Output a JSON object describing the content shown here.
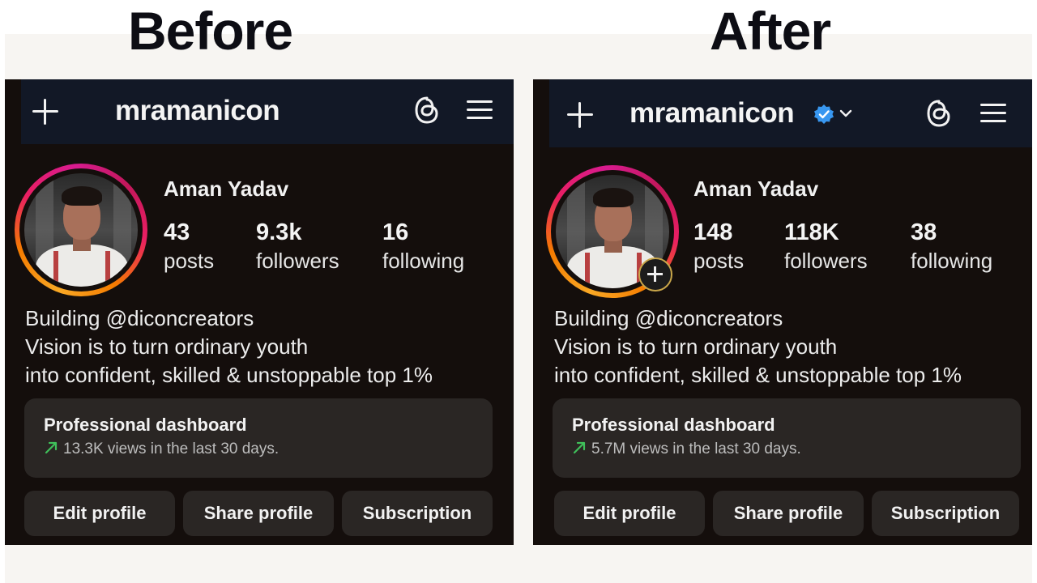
{
  "labels": {
    "before": "Before",
    "after": "After"
  },
  "before": {
    "username": "mramanicon",
    "full_name": "Aman Yadav",
    "stats": [
      {
        "value": "43",
        "label": "posts"
      },
      {
        "value": "9.3k",
        "label": "followers"
      },
      {
        "value": "16",
        "label": "following"
      }
    ],
    "bio": [
      "Building @diconcreators",
      "Vision is to turn ordinary youth",
      "into confident, skilled & unstoppable top 1%"
    ],
    "dashboard": {
      "title": "Professional dashboard",
      "subtitle": "13.3K views in the last 30 days."
    },
    "buttons": {
      "edit": "Edit profile",
      "share": "Share profile",
      "subscription": "Subscription"
    }
  },
  "after": {
    "username": "mramanicon",
    "full_name": "Aman Yadav",
    "stats": [
      {
        "value": "148",
        "label": "posts"
      },
      {
        "value": "118K",
        "label": "followers"
      },
      {
        "value": "38",
        "label": "following"
      }
    ],
    "bio": [
      "Building @diconcreators",
      "Vision is to turn ordinary youth",
      "into confident, skilled & unstoppable top 1%"
    ],
    "dashboard": {
      "title": "Professional dashboard",
      "subtitle": "5.7M views in the last 30 days."
    },
    "buttons": {
      "edit": "Edit profile",
      "share": "Share profile",
      "subscription": "Subscription"
    }
  },
  "colors": {
    "panel_bg": "#140e0c",
    "topbar_bg": "#121826",
    "card_bg": "#2a2624",
    "verified": "#3897f0",
    "trend": "#3fbf5a"
  },
  "icons": [
    "plus-icon",
    "threads-icon",
    "menu-icon",
    "verified-badge-icon",
    "chevron-down-icon",
    "trend-up-icon",
    "add-story-icon"
  ]
}
